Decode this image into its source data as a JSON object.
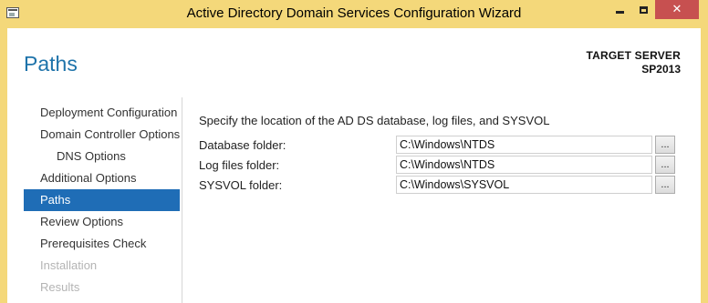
{
  "window": {
    "title": "Active Directory Domain Services Configuration Wizard",
    "close_glyph": "✕"
  },
  "header": {
    "page_title": "Paths",
    "target_server_label": "TARGET SERVER",
    "target_server_name": "SP2013"
  },
  "nav": {
    "items": [
      {
        "label": "Deployment Configuration",
        "state": "normal"
      },
      {
        "label": "Domain Controller Options",
        "state": "normal"
      },
      {
        "label": "DNS Options",
        "state": "normal"
      },
      {
        "label": "Additional Options",
        "state": "normal"
      },
      {
        "label": "Paths",
        "state": "active"
      },
      {
        "label": "Review Options",
        "state": "normal"
      },
      {
        "label": "Prerequisites Check",
        "state": "normal"
      },
      {
        "label": "Installation",
        "state": "disabled"
      },
      {
        "label": "Results",
        "state": "disabled"
      }
    ]
  },
  "content": {
    "instruction": "Specify the location of the AD DS database, log files, and SYSVOL",
    "fields": [
      {
        "label": "Database folder:",
        "value": "C:\\Windows\\NTDS",
        "browse_label": "..."
      },
      {
        "label": "Log files folder:",
        "value": "C:\\Windows\\NTDS",
        "browse_label": "..."
      },
      {
        "label": "SYSVOL folder:",
        "value": "C:\\Windows\\SYSVOL",
        "browse_label": "..."
      }
    ]
  },
  "colors": {
    "titlebar": "#f4d87a",
    "accent": "#1f6db6",
    "page_title": "#1e73aa",
    "close_button": "#c75050"
  }
}
